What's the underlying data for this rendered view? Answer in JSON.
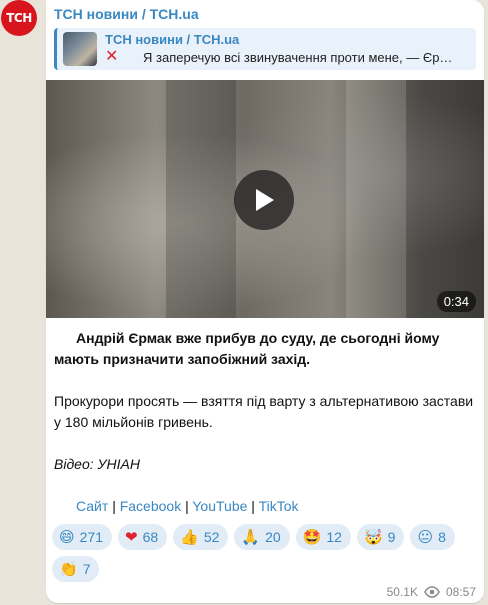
{
  "channel": {
    "avatar_text": "ТСН",
    "avatar_color": "#d8141c",
    "name": "ТСН новини / TCH.ua"
  },
  "reply": {
    "name": "ТСН новини / TCH.ua",
    "icon": "red-x-icon",
    "text": "Я заперечую всі звинувачення проти мене, — Єр…"
  },
  "video": {
    "duration": "0:34",
    "icon": "play-icon"
  },
  "post": {
    "para1": "Андрій Єрмак вже прибув до суду, де сьогодні йому мають призначити запобіжний захід.",
    "para2": "Прокурори просять — взяття під варту з альтернативою застави у 180 мільйонів гривень.",
    "source": "Відео: УНІАН",
    "links": [
      {
        "label": "Сайт"
      },
      {
        "label": "Facebook"
      },
      {
        "label": "YouTube"
      },
      {
        "label": "TikTok"
      }
    ],
    "separator": "|"
  },
  "reactions": [
    {
      "emoji": "😄",
      "icon": "grinning-face-icon",
      "count": "271"
    },
    {
      "emoji": "❤",
      "icon": "red-heart-icon",
      "count": "68"
    },
    {
      "emoji": "👍",
      "icon": "thumbs-up-icon",
      "count": "52"
    },
    {
      "emoji": "🙏",
      "icon": "folded-hands-icon",
      "count": "20"
    },
    {
      "emoji": "🤩",
      "icon": "star-struck-icon",
      "count": "12"
    },
    {
      "emoji": "🤯",
      "icon": "exploding-head-icon",
      "count": "9"
    },
    {
      "emoji": "😐",
      "icon": "neutral-face-icon",
      "count": "8"
    },
    {
      "emoji": "👏",
      "icon": "clapping-hands-icon",
      "count": "7"
    }
  ],
  "meta": {
    "views": "50.1K",
    "views_icon": "eye-icon",
    "time": "08:57"
  },
  "colors": {
    "accent": "#3a87c2",
    "reaction_bg": "#e1ecf6",
    "chat_bg": "#e8e4da"
  }
}
